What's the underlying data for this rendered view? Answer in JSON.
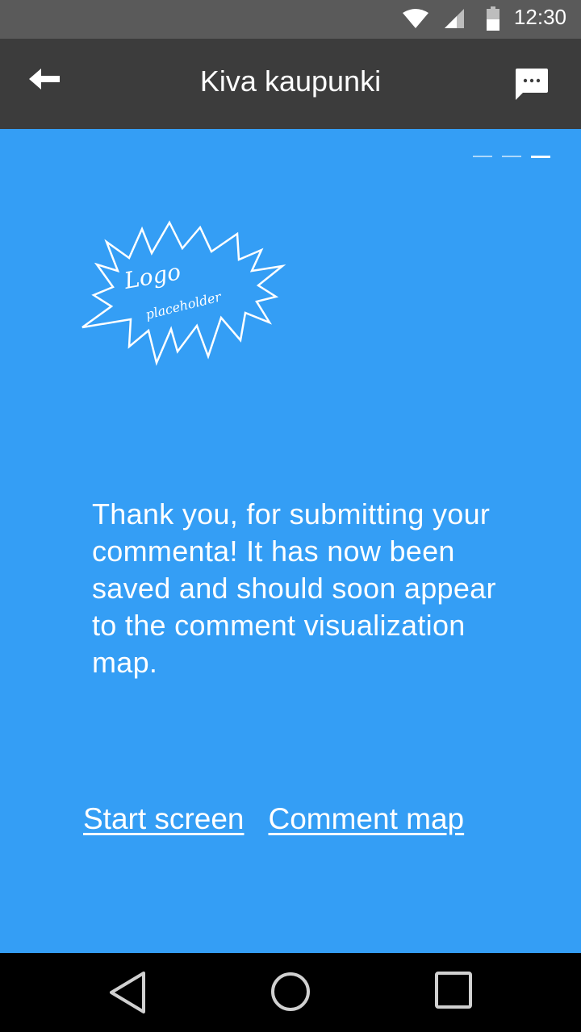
{
  "status_bar": {
    "time": "12:30",
    "icons": [
      "wifi-icon",
      "cell-signal-icon",
      "battery-icon"
    ]
  },
  "app_bar": {
    "title": "Kiva kaupunki",
    "back_icon": "arrow-left-icon",
    "action_icon": "chat-bubble-icon"
  },
  "pager": {
    "total": 3,
    "active_index": 3
  },
  "logo": {
    "line1": "Logo",
    "line2": "placeholder"
  },
  "message": {
    "text": "Thank you, for submitting your commenta! It has now been saved and should soon appear to the comment visualization map."
  },
  "links": {
    "start_screen": "Start screen",
    "comment_map": "Comment map"
  },
  "nav_bar": {
    "icons": [
      "back-triangle-icon",
      "home-circle-icon",
      "recents-square-icon"
    ]
  },
  "colors": {
    "status_bar": "#5a5a5a",
    "app_bar": "#3c3c3c",
    "content_background": "#349ef5",
    "text": "#ffffff",
    "nav_bar": "#000000"
  }
}
